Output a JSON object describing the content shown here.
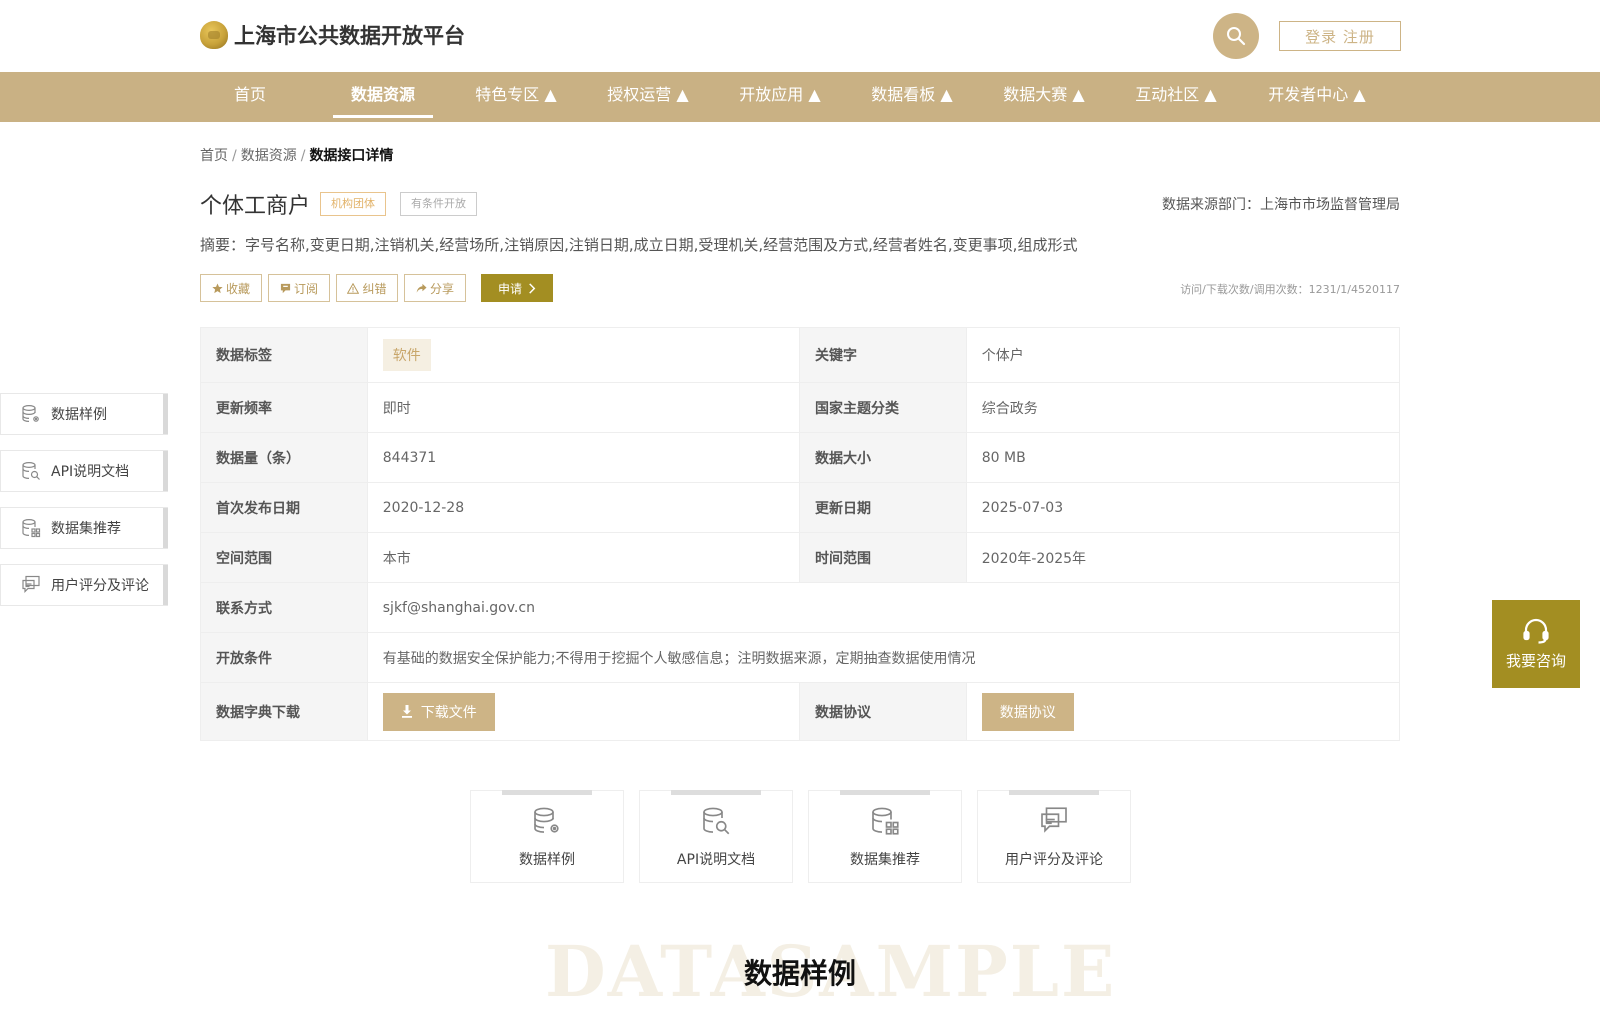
{
  "header": {
    "logo_text": "上海市公共数据开放平台",
    "login_label": "登录 注册"
  },
  "nav": {
    "items": [
      {
        "label": "首页"
      },
      {
        "label": "数据资源"
      },
      {
        "label": "特色专区 ▲"
      },
      {
        "label": "授权运营 ▲"
      },
      {
        "label": "开放应用 ▲"
      },
      {
        "label": "数据看板 ▲"
      },
      {
        "label": "数据大赛 ▲"
      },
      {
        "label": "互动社区 ▲"
      },
      {
        "label": "开发者中心 ▲"
      }
    ],
    "active": "数据资源"
  },
  "breadcrumb": {
    "home": "首页",
    "sep1": "/",
    "resources": "数据资源",
    "sep2": "/",
    "current": "数据接口详情"
  },
  "dataset": {
    "title": "个体工商户",
    "badge_org": "机构团体",
    "badge_condition": "有条件开放",
    "source": "数据来源部门：上海市市场监督管理局",
    "summary": "摘要：字号名称,变更日期,注销机关,经营场所,注销原因,注销日期,成立日期,受理机关,经营范围及方式,经营者姓名,变更事项,组成形式"
  },
  "actions": {
    "favorite": "收藏",
    "subscribe": "订阅",
    "report": "纠错",
    "share": "分享",
    "apply": "申请",
    "stats": "访问/下载次数/调用次数：1231/1/4520117"
  },
  "table": {
    "tag_label": "数据标签",
    "tag_value": "软件",
    "keyword_label": "关键字",
    "keyword_value": "个体户",
    "freq_label": "更新频率",
    "freq_value": "即时",
    "theme_label": "国家主题分类",
    "theme_value": "综合政务",
    "count_label": "数据量（条）",
    "count_value": "844371",
    "size_label": "数据大小",
    "size_value": "80 MB",
    "first_label": "首次发布日期",
    "first_value": "2020-12-28",
    "update_label": "更新日期",
    "update_value": "2025-07-03",
    "space_label": "空间范围",
    "space_value": "本市",
    "time_label": "时间范围",
    "time_value": "2020年-2025年",
    "contact_label": "联系方式",
    "contact_value": "sjkf@shanghai.gov.cn",
    "open_label": "开放条件",
    "open_value": "有基础的数据安全保护能力;不得用于挖掘个人敏感信息；注明数据来源，定期抽查数据使用情况",
    "dict_label": "数据字典下载",
    "dict_button": "下载文件",
    "agreement_label": "数据协议",
    "agreement_button": "数据协议"
  },
  "side_nav": {
    "items": [
      {
        "label": "数据样例",
        "icon": "database-gear-icon"
      },
      {
        "label": "API说明文档",
        "icon": "document-search-icon"
      },
      {
        "label": "数据集推荐",
        "icon": "database-grid-icon"
      },
      {
        "label": "用户评分及评论",
        "icon": "comment-icon"
      }
    ]
  },
  "consult": {
    "label": "我要咨询"
  },
  "cards": {
    "items": [
      {
        "label": "数据样例"
      },
      {
        "label": "API说明文档"
      },
      {
        "label": "数据集推荐"
      },
      {
        "label": "用户评分及评论"
      }
    ]
  },
  "section": {
    "bg_text": "DATASAMPLE",
    "title": "数据样例"
  },
  "colors": {
    "gold": "#c9b184",
    "olive": "#a38e22",
    "chip_bg": "#f5efe2"
  }
}
